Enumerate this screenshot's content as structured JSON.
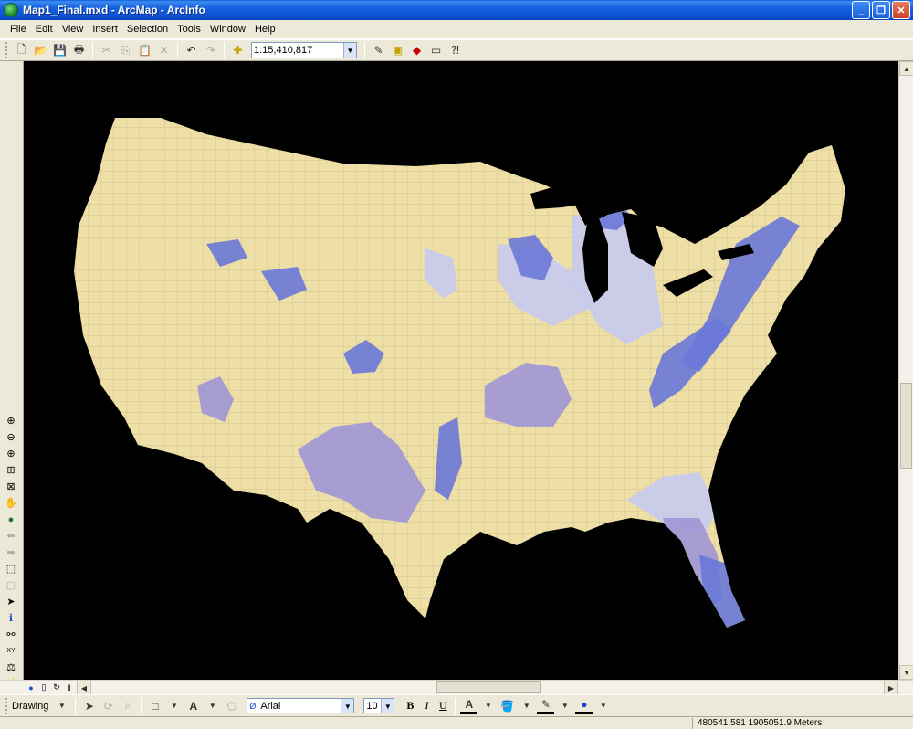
{
  "window": {
    "title": "Map1_Final.mxd - ArcMap - ArcInfo"
  },
  "menu": [
    {
      "label": "File"
    },
    {
      "label": "Edit"
    },
    {
      "label": "View"
    },
    {
      "label": "Insert"
    },
    {
      "label": "Selection"
    },
    {
      "label": "Tools"
    },
    {
      "label": "Window"
    },
    {
      "label": "Help"
    }
  ],
  "toolbar": {
    "scale": "1:15,410,817"
  },
  "drawing": {
    "label": "Drawing",
    "font": "Arial",
    "font_size": "10",
    "bold": "B",
    "italic": "I",
    "underline": "U",
    "text_tool": "A"
  },
  "status": {
    "coordinates": "480541.581  1905051.9 Meters"
  },
  "colors": {
    "land": "#eedfa6",
    "aquifer_blue": "#6a78d8",
    "aquifer_light": "#c6cbef",
    "aquifer_purple": "#9f96d6",
    "map_bg": "#000000"
  }
}
